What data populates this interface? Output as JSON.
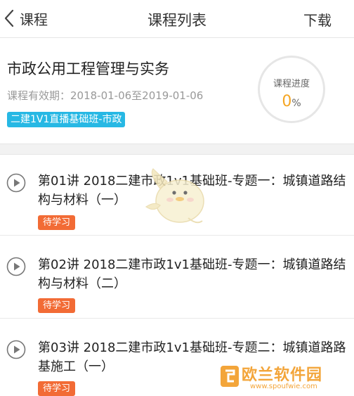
{
  "nav": {
    "back_label": "课程",
    "title": "课程列表",
    "download_label": "下载"
  },
  "course": {
    "title": "市政公用工程管理与实务",
    "validity": "课程有效期：2018-01-06至2019-01-06",
    "tag": "二建1V1直播基础班-市政",
    "progress_label": "课程进度",
    "progress_value": "0",
    "progress_unit": "%"
  },
  "lessons": [
    {
      "title": "第01讲 2018二建市政1v1基础班-专题一：城镇道路结构与材料（一）",
      "status": "待学习"
    },
    {
      "title": "第02讲 2018二建市政1v1基础班-专题一：城镇道路结构与材料（二）",
      "status": "待学习"
    },
    {
      "title": "第03讲 2018二建市政1v1基础班-专题二：城镇道路路基施工（一）",
      "status": "待学习"
    }
  ],
  "watermark": {
    "text": "欧兰软件园",
    "url": "www.spoufwie.com"
  },
  "colors": {
    "tag_blue": "#27b8e4",
    "status_orange": "#f26b35",
    "progress_orange": "#f5a623"
  },
  "icons": {
    "back": "chevron-left-icon",
    "play": "play-circle-icon"
  }
}
